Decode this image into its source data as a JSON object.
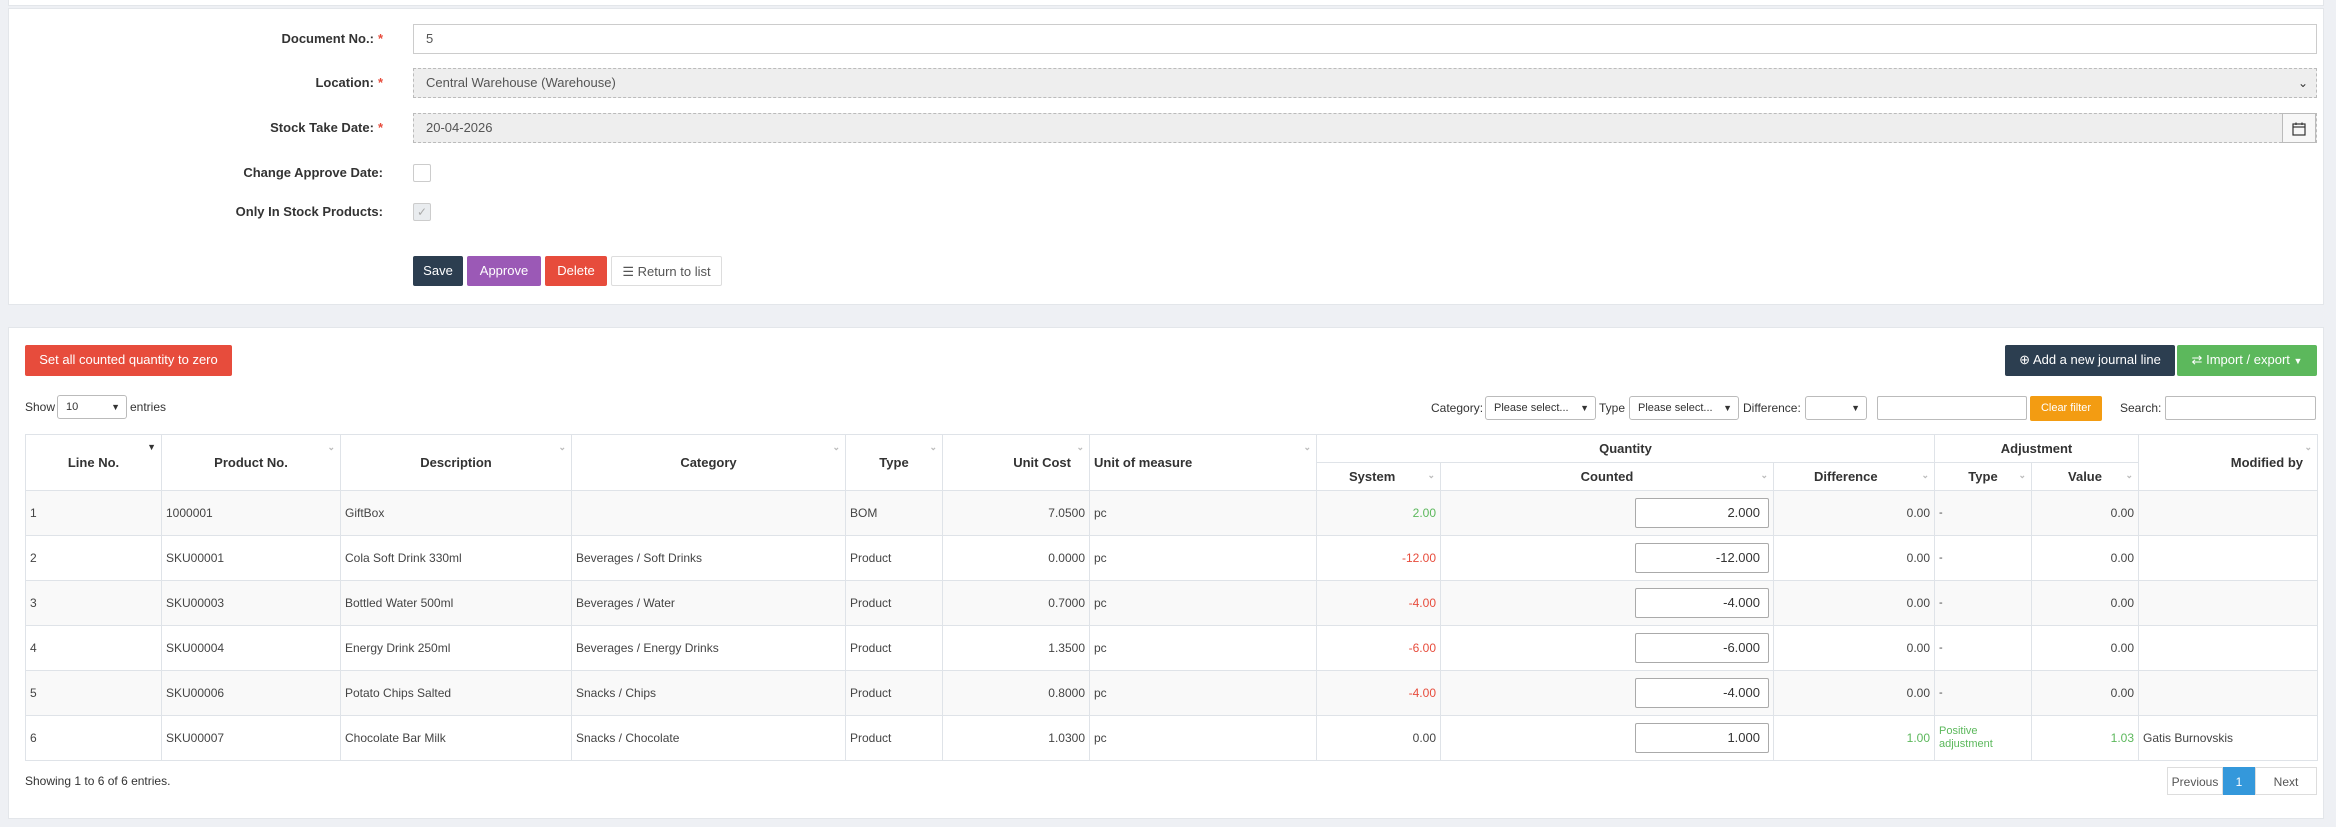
{
  "form": {
    "document_no": {
      "label": "Document No.:",
      "value": "5"
    },
    "location": {
      "label": "Location:",
      "value": "Central Warehouse (Warehouse)"
    },
    "stock_take_date": {
      "label": "Stock Take Date:",
      "value": "20-04-2026"
    },
    "change_approve_date": {
      "label": "Change Approve Date:"
    },
    "only_in_stock": {
      "label": "Only In Stock Products:"
    },
    "buttons": {
      "save": "Save",
      "approve": "Approve",
      "delete": "Delete",
      "return": "Return to list"
    }
  },
  "toolbar": {
    "zero_button": "Set all counted quantity to zero",
    "add_line_button": "Add a new journal line",
    "import_export_button": "Import / export",
    "show_label": "Show",
    "page_size": "10",
    "entries_label": "entries",
    "category_label": "Category:",
    "category_value": "Please select...",
    "type_label": "Type",
    "type_value": "Please select...",
    "difference_label": "Difference:",
    "clear_filter": "Clear filter",
    "search_label": "Search:"
  },
  "table": {
    "headers": {
      "line_no": "Line No.",
      "product_no": "Product No.",
      "description": "Description",
      "category": "Category",
      "type": "Type",
      "unit_cost": "Unit Cost",
      "unit_of_measure": "Unit of measure",
      "quantity": "Quantity",
      "system": "System",
      "counted": "Counted",
      "difference": "Difference",
      "adjustment": "Adjustment",
      "adj_type": "Type",
      "adj_value": "Value",
      "modified_by": "Modified by"
    },
    "rows": [
      {
        "line": "1",
        "product": "1000001",
        "desc": "GiftBox",
        "cat": "",
        "type": "BOM",
        "cost": "7.0500",
        "uom": "pc",
        "system": "2.00",
        "counted": "2.000",
        "diff": "0.00",
        "adj_type": "-",
        "adj_value": "0.00",
        "modified": ""
      },
      {
        "line": "2",
        "product": "SKU00001",
        "desc": "Cola Soft Drink 330ml",
        "cat": "Beverages / Soft Drinks",
        "type": "Product",
        "cost": "0.0000",
        "uom": "pc",
        "system": "-12.00",
        "counted": "-12.000",
        "diff": "0.00",
        "adj_type": "-",
        "adj_value": "0.00",
        "modified": ""
      },
      {
        "line": "3",
        "product": "SKU00003",
        "desc": "Bottled Water 500ml",
        "cat": "Beverages / Water",
        "type": "Product",
        "cost": "0.7000",
        "uom": "pc",
        "system": "-4.00",
        "counted": "-4.000",
        "diff": "0.00",
        "adj_type": "-",
        "adj_value": "0.00",
        "modified": ""
      },
      {
        "line": "4",
        "product": "SKU00004",
        "desc": "Energy Drink 250ml",
        "cat": "Beverages / Energy Drinks",
        "type": "Product",
        "cost": "1.3500",
        "uom": "pc",
        "system": "-6.00",
        "counted": "-6.000",
        "diff": "0.00",
        "adj_type": "-",
        "adj_value": "0.00",
        "modified": ""
      },
      {
        "line": "5",
        "product": "SKU00006",
        "desc": "Potato Chips Salted",
        "cat": "Snacks / Chips",
        "type": "Product",
        "cost": "0.8000",
        "uom": "pc",
        "system": "-4.00",
        "counted": "-4.000",
        "diff": "0.00",
        "adj_type": "-",
        "adj_value": "0.00",
        "modified": ""
      },
      {
        "line": "6",
        "product": "SKU00007",
        "desc": "Chocolate Bar Milk",
        "cat": "Snacks / Chocolate",
        "type": "Product",
        "cost": "1.0300",
        "uom": "pc",
        "system": "0.00",
        "counted": "1.000",
        "diff": "1.00",
        "adj_type": "Positive adjustment",
        "adj_value": "1.03",
        "modified": "Gatis Burnovskis"
      }
    ]
  },
  "footer": {
    "showing": "Showing 1 to 6 of 6 entries.",
    "previous": "Previous",
    "page": "1",
    "next": "Next"
  },
  "colors": {
    "positive": "#5cb85c",
    "negative": "#e74c3c",
    "primary_dark": "#2c3e50",
    "accent_purple": "#9b59b6",
    "orange": "#f39c12"
  }
}
